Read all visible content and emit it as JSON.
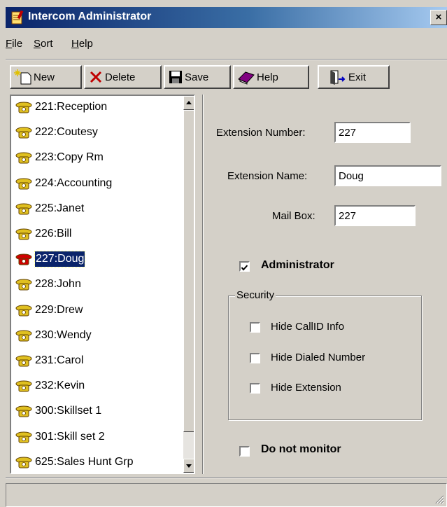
{
  "window": {
    "title": "Intercom Administrator",
    "close_label": "×",
    "icon": "notepad-icon"
  },
  "menu": [
    {
      "label_ul": "F",
      "label_rest": "ile"
    },
    {
      "label_ul": "S",
      "label_rest": "ort"
    },
    {
      "label_ul": "H",
      "label_rest": "elp"
    }
  ],
  "toolbar": {
    "new_label": "New",
    "delete_label": "Delete",
    "save_label": "Save",
    "help_label": "Help",
    "exit_label": "Exit"
  },
  "extensions": [
    {
      "label": "221:Reception"
    },
    {
      "label": "222:Coutesy"
    },
    {
      "label": "223:Copy Rm"
    },
    {
      "label": "224:Accounting"
    },
    {
      "label": "225:Janet"
    },
    {
      "label": "226:Bill"
    },
    {
      "label": "227:Doug",
      "selected": true
    },
    {
      "label": "228:John"
    },
    {
      "label": "229:Drew"
    },
    {
      "label": "230:Wendy"
    },
    {
      "label": "231:Carol"
    },
    {
      "label": "232:Kevin"
    },
    {
      "label": "300:Skillset 1"
    },
    {
      "label": "301:Skill set 2"
    },
    {
      "label": "625:Sales Hunt Grp"
    }
  ],
  "form": {
    "ext_number_label": "Extension Number:",
    "ext_number_value": "227",
    "ext_name_label": "Extension Name:",
    "ext_name_value": "Doug",
    "mailbox_label": "Mail Box:",
    "mailbox_value": "227",
    "administrator_label": "Administrator",
    "administrator_checked": true,
    "security_label": "Security",
    "hide_callid_label": "Hide CallID Info",
    "hide_dialed_label": "Hide Dialed Number",
    "hide_extension_label": "Hide Extension",
    "do_not_monitor_label": "Do not monitor"
  },
  "colors": {
    "titlebar_start": "#0a246a",
    "titlebar_end": "#a6caf0",
    "selection": "#0a246a",
    "face": "#d4d0c8"
  }
}
